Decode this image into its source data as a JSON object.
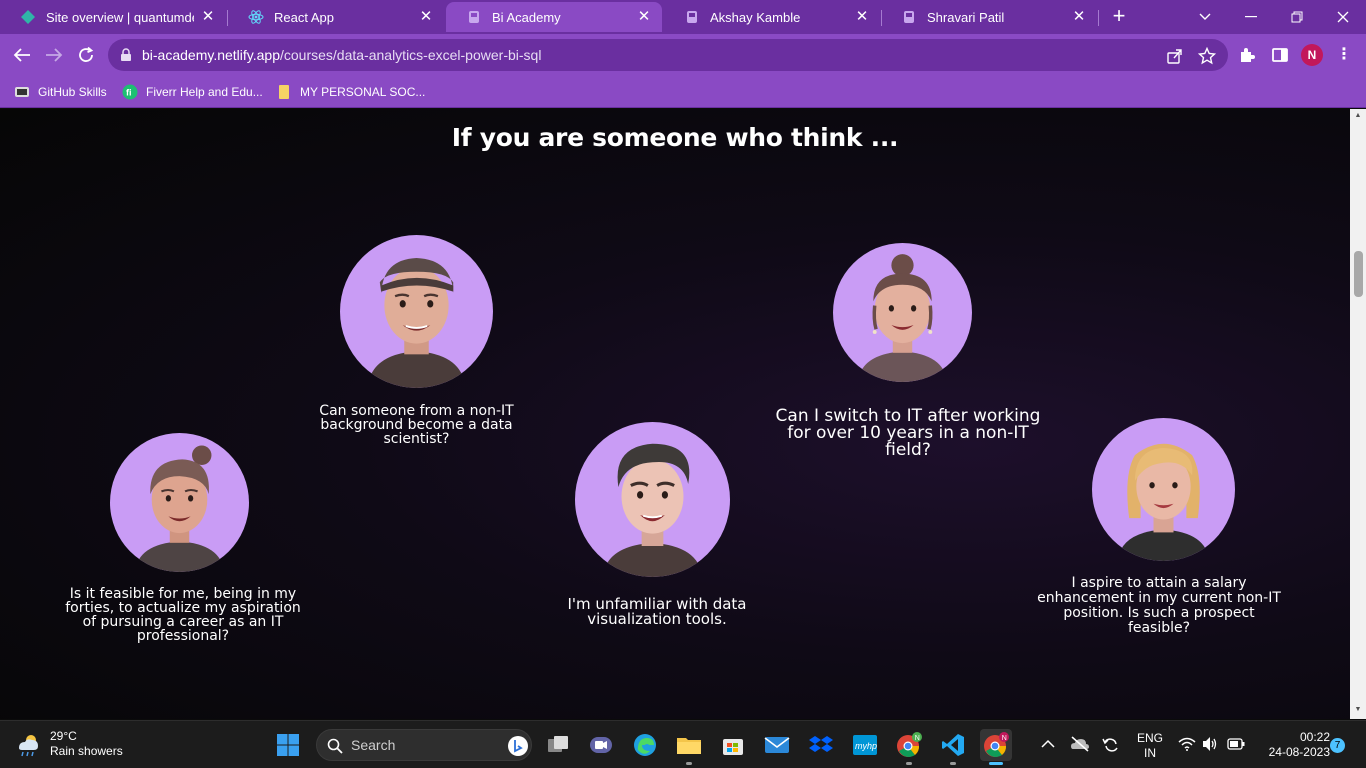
{
  "browser": {
    "tabs": [
      {
        "title": "Site overview | quantumdesig",
        "favicon": "netlify-diamond-icon",
        "active": false
      },
      {
        "title": "React App",
        "favicon": "react-icon",
        "active": false
      },
      {
        "title": "Bi Academy",
        "favicon": "bi-academy-icon",
        "active": true
      },
      {
        "title": "Akshay Kamble",
        "favicon": "bi-academy-icon",
        "active": false
      },
      {
        "title": "Shravari Patil",
        "favicon": "bi-academy-icon",
        "active": false
      }
    ],
    "url_host": "bi-academy.netlify.app",
    "url_path": "/courses/data-analytics-excel-power-bi-sql",
    "profile_initial": "N",
    "bookmarks": [
      {
        "label": "GitHub Skills",
        "icon": "github-icon"
      },
      {
        "label": "Fiverr Help and Edu...",
        "icon": "fiverr-icon"
      },
      {
        "label": "MY PERSONAL SOC...",
        "icon": "folder-icon"
      }
    ],
    "theme_color": "#8a4ac4"
  },
  "page": {
    "heading": "If you are someone who think ...",
    "personas": [
      {
        "quote": "Can someone from a non-IT background become a data scientist?",
        "avatar": "man-with-cap"
      },
      {
        "quote": "Can I switch to IT after working for over 10 years in a non-IT field?",
        "avatar": "woman-with-bun"
      },
      {
        "quote": "Is it feasible for me, being in my forties, to actualize my aspiration of pursuing a career as an IT professional?",
        "avatar": "man-with-topknot"
      },
      {
        "quote": "I'm unfamiliar with data visualization tools.",
        "avatar": "young-man"
      },
      {
        "quote": "I aspire to attain a salary enhancement in my current non-IT position. Is such a prospect feasible?",
        "avatar": "blonde-woman"
      }
    ],
    "avatar_bg": "#c99cf5"
  },
  "taskbar": {
    "weather_temp": "29°C",
    "weather_desc": "Rain showers",
    "search_placeholder": "Search",
    "lang_top": "ENG",
    "lang_bottom": "IN",
    "time": "00:22",
    "date": "24-08-2023",
    "notification_count": "7"
  }
}
